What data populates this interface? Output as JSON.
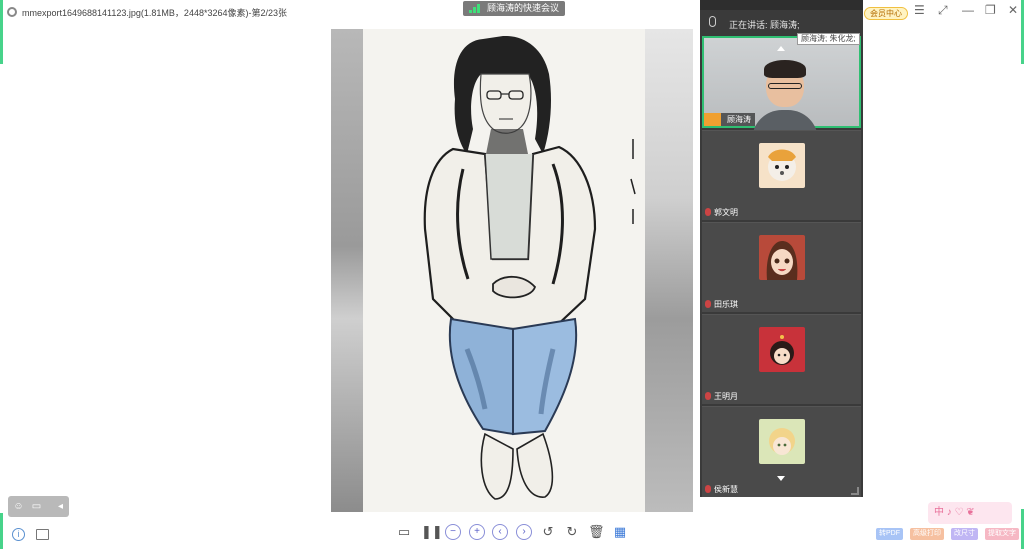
{
  "window": {
    "file_title": "mmexport1649688141123.jpg(1.81MB，2448*3264像素)-第2/23张",
    "meeting_name": "顾海涛的快速会议",
    "member_badge": "会员中心"
  },
  "viewer": {
    "toolbar_icons": [
      "monitor-icon",
      "pause-icon",
      "zoom-out-icon",
      "zoom-in-icon",
      "prev-icon",
      "next-icon",
      "rotate-left-icon",
      "rotate-right-icon",
      "delete-icon",
      "grid-icon"
    ],
    "bottom_right_buttons": [
      "转PDF",
      "高级打印",
      "改尺寸",
      "提取文字"
    ],
    "sticker_text": "中 ♪ ♡ ❦"
  },
  "meeting_panel": {
    "speaking_label": "正在讲话: 顾海涛;",
    "tooltip": "顾海涛; 朱化龙;",
    "participants": [
      {
        "name": "顾海涛",
        "camera_on": true,
        "host": true
      },
      {
        "name": "郭文明",
        "camera_on": false
      },
      {
        "name": "田乐琪",
        "camera_on": false
      },
      {
        "name": "王明月",
        "camera_on": false
      },
      {
        "name": "侯新慧",
        "camera_on": false
      }
    ]
  },
  "colors": {
    "accent_green": "#47d38a",
    "panel_bg": "#3a3a3a",
    "tile_bg": "#4a4a4a",
    "active_border": "#2fbf72"
  }
}
